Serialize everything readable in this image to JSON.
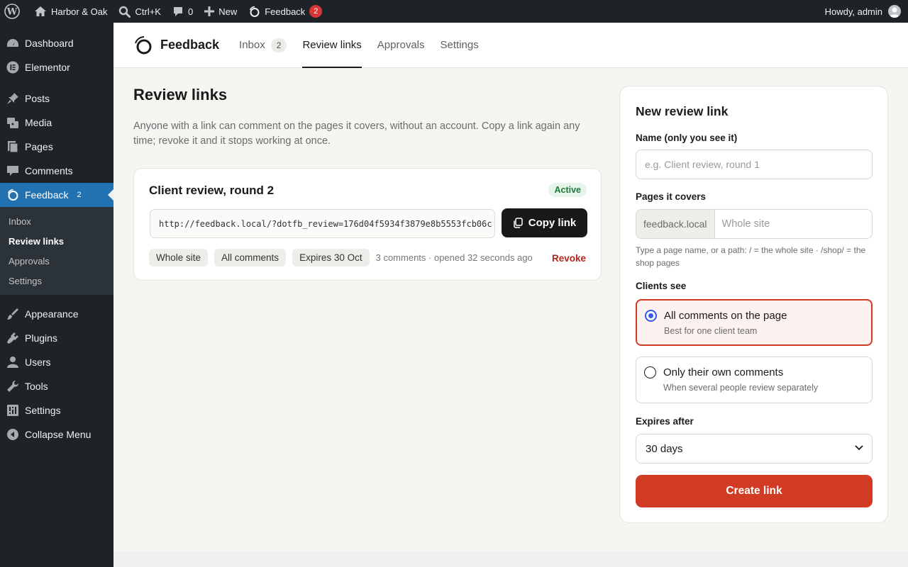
{
  "adminbar": {
    "site_name": "Harbor & Oak",
    "search_shortcut": "Ctrl+K",
    "comments_count": "0",
    "new_label": "New",
    "feedback_label": "Feedback",
    "feedback_badge": "2",
    "howdy": "Howdy, admin"
  },
  "sidebar": {
    "items": [
      {
        "label": "Dashboard",
        "icon": "dashboard-icon"
      },
      {
        "label": "Elementor",
        "icon": "elementor-icon"
      },
      {
        "label": "Posts",
        "icon": "pin-icon"
      },
      {
        "label": "Media",
        "icon": "media-icon"
      },
      {
        "label": "Pages",
        "icon": "pages-icon"
      },
      {
        "label": "Comments",
        "icon": "comment-icon"
      },
      {
        "label": "Feedback",
        "icon": "feedback-icon",
        "count": "2"
      },
      {
        "label": "Appearance",
        "icon": "brush-icon"
      },
      {
        "label": "Plugins",
        "icon": "plug-icon"
      },
      {
        "label": "Users",
        "icon": "user-icon"
      },
      {
        "label": "Tools",
        "icon": "wrench-icon"
      },
      {
        "label": "Settings",
        "icon": "sliders-icon"
      },
      {
        "label": "Collapse Menu",
        "icon": "collapse-icon"
      }
    ],
    "submenu": [
      "Inbox",
      "Review links",
      "Approvals",
      "Settings"
    ]
  },
  "header": {
    "brand": "Feedback",
    "tabs": [
      {
        "label": "Inbox",
        "count": "2"
      },
      {
        "label": "Review links"
      },
      {
        "label": "Approvals"
      },
      {
        "label": "Settings"
      }
    ]
  },
  "main": {
    "title": "Review links",
    "intro": "Anyone with a link can comment on the pages it covers, without an account. Copy a link again any time; revoke it and it stops working at once.",
    "link": {
      "name": "Client review, round 2",
      "status": "Active",
      "url": "http://feedback.local/?dotfb_review=176d04f5934f3879e8b5553fcb06c",
      "copy_label": "Copy link",
      "chips": [
        "Whole site",
        "All comments",
        "Expires 30 Oct"
      ],
      "meta": "3 comments · opened 32 seconds ago",
      "revoke_label": "Revoke"
    }
  },
  "form": {
    "title": "New review link",
    "name_label": "Name (only you see it)",
    "name_placeholder": "e.g. Client review, round 1",
    "pages_label": "Pages it covers",
    "pages_prefix": "feedback.local",
    "pages_placeholder": "Whole site",
    "pages_hint": "Type a page name, or a path: / = the whole site · /shop/ = the shop pages",
    "visibility_label": "Clients see",
    "options": [
      {
        "title": "All comments on the page",
        "sub": "Best for one client team"
      },
      {
        "title": "Only their own comments",
        "sub": "When several people review separately"
      }
    ],
    "expires_label": "Expires after",
    "expires_value": "30 days",
    "create_label": "Create link"
  },
  "colors": {
    "accent": "#d23b23",
    "wp_blue": "#2271b1",
    "active_green": "#1e7a3a",
    "radio_blue": "#3858e9"
  }
}
